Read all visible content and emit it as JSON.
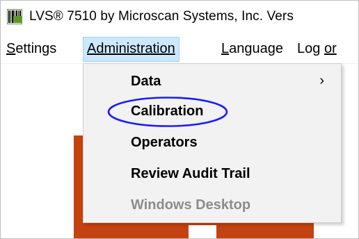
{
  "window": {
    "title": "LVS® 7510 by Microscan Systems, Inc.  Vers",
    "icon": "barcode-app-icon"
  },
  "menubar": {
    "items": [
      {
        "label_underlined": "S",
        "label_rest": "ettings"
      },
      {
        "label_underlined": "A",
        "label_rest": "dministration"
      },
      {
        "label_underlined": "L",
        "label_rest": "anguage"
      },
      {
        "label_prefix": "Log ",
        "label_underlined": "o",
        "label_rest": "r"
      }
    ]
  },
  "administration_menu": {
    "items": [
      {
        "label": "Data",
        "has_submenu": true,
        "submenu_glyph": "›"
      },
      {
        "label": "Calibration",
        "highlighted_with_circle": true
      },
      {
        "label": "Operators"
      },
      {
        "label": "Review Audit Trail"
      },
      {
        "label": "Windows Desktop",
        "disabled": true
      }
    ]
  },
  "colors": {
    "menu_active_bg": "#cce8ff",
    "dropdown_bg": "#f2f2f2",
    "annotation_circle": "#1a1aff",
    "background_block": "#c4420f",
    "disabled_text": "#8c8c8c"
  }
}
